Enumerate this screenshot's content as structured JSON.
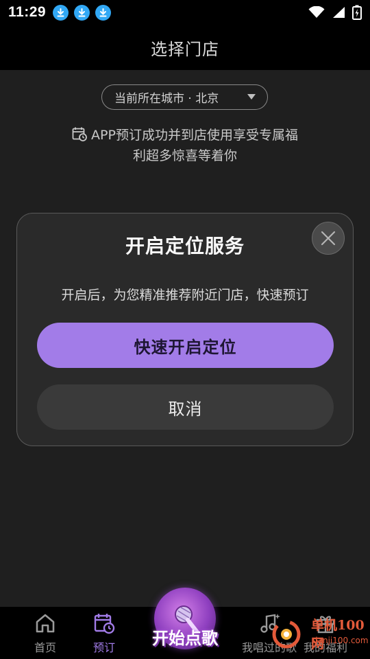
{
  "status_bar": {
    "time": "11:29"
  },
  "header": {
    "title": "选择门店"
  },
  "city_selector": {
    "label": "当前所在城市 · 北京"
  },
  "promo": {
    "line1": "APP预订成功并到店使用享受专属福",
    "line2": "利超多惊喜等着你"
  },
  "modal": {
    "title": "开启定位服务",
    "description": "开启后，为您精准推荐附近门店，快速预订",
    "primary_button": "快速开启定位",
    "secondary_button": "取消"
  },
  "bottom_nav": {
    "items": [
      {
        "label": "首页",
        "icon": "home-icon",
        "active": false
      },
      {
        "label": "预订",
        "icon": "calendar-clock-icon",
        "active": true
      },
      {
        "label": "我唱过的歌",
        "icon": "music-note-icon",
        "active": false
      },
      {
        "label": "我的福利",
        "icon": "gift-icon",
        "active": false
      }
    ],
    "center_label": "开始点歌"
  },
  "watermark": {
    "text1": "单机100网",
    "text2": "danji100.com"
  },
  "colors": {
    "accent": "#a27ce8",
    "background": "#1f1f1f",
    "download_badge": "#31a8f5"
  }
}
